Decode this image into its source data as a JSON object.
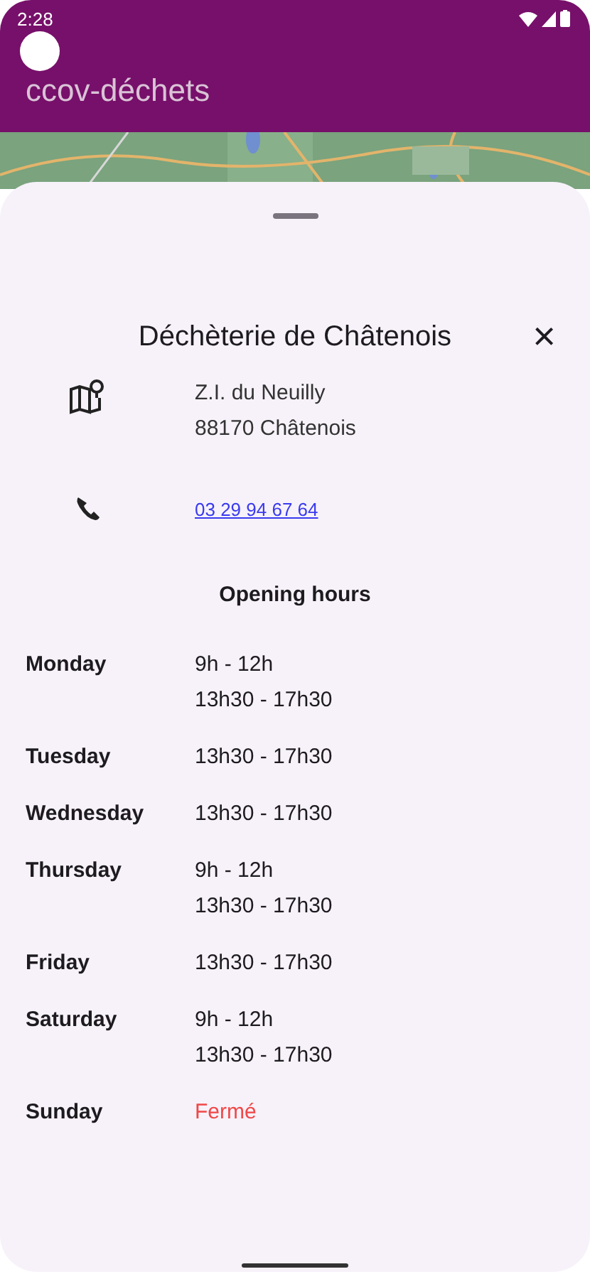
{
  "status_bar": {
    "time": "2:28"
  },
  "app_bar": {
    "title": "ccov-déchets"
  },
  "sheet": {
    "title": "Déchèterie de Châtenois",
    "close": "×",
    "address": [
      "Z.I. du Neuilly",
      "88170 Châtenois"
    ],
    "phone": "03 29 94 67 64",
    "hours_title": "Opening hours",
    "hours": [
      {
        "day": "Monday",
        "closed": false,
        "slots": [
          "9h - 12h",
          "13h30 - 17h30"
        ]
      },
      {
        "day": "Tuesday",
        "closed": false,
        "slots": [
          "13h30 - 17h30"
        ]
      },
      {
        "day": "Wednesday",
        "closed": false,
        "slots": [
          "13h30 - 17h30"
        ]
      },
      {
        "day": "Thursday",
        "closed": false,
        "slots": [
          "9h - 12h",
          "13h30 - 17h30"
        ]
      },
      {
        "day": "Friday",
        "closed": false,
        "slots": [
          "13h30 - 17h30"
        ]
      },
      {
        "day": "Saturday",
        "closed": false,
        "slots": [
          "9h - 12h",
          "13h30 - 17h30"
        ]
      },
      {
        "day": "Sunday",
        "closed": true,
        "slots": [
          "Fermé"
        ]
      }
    ]
  }
}
